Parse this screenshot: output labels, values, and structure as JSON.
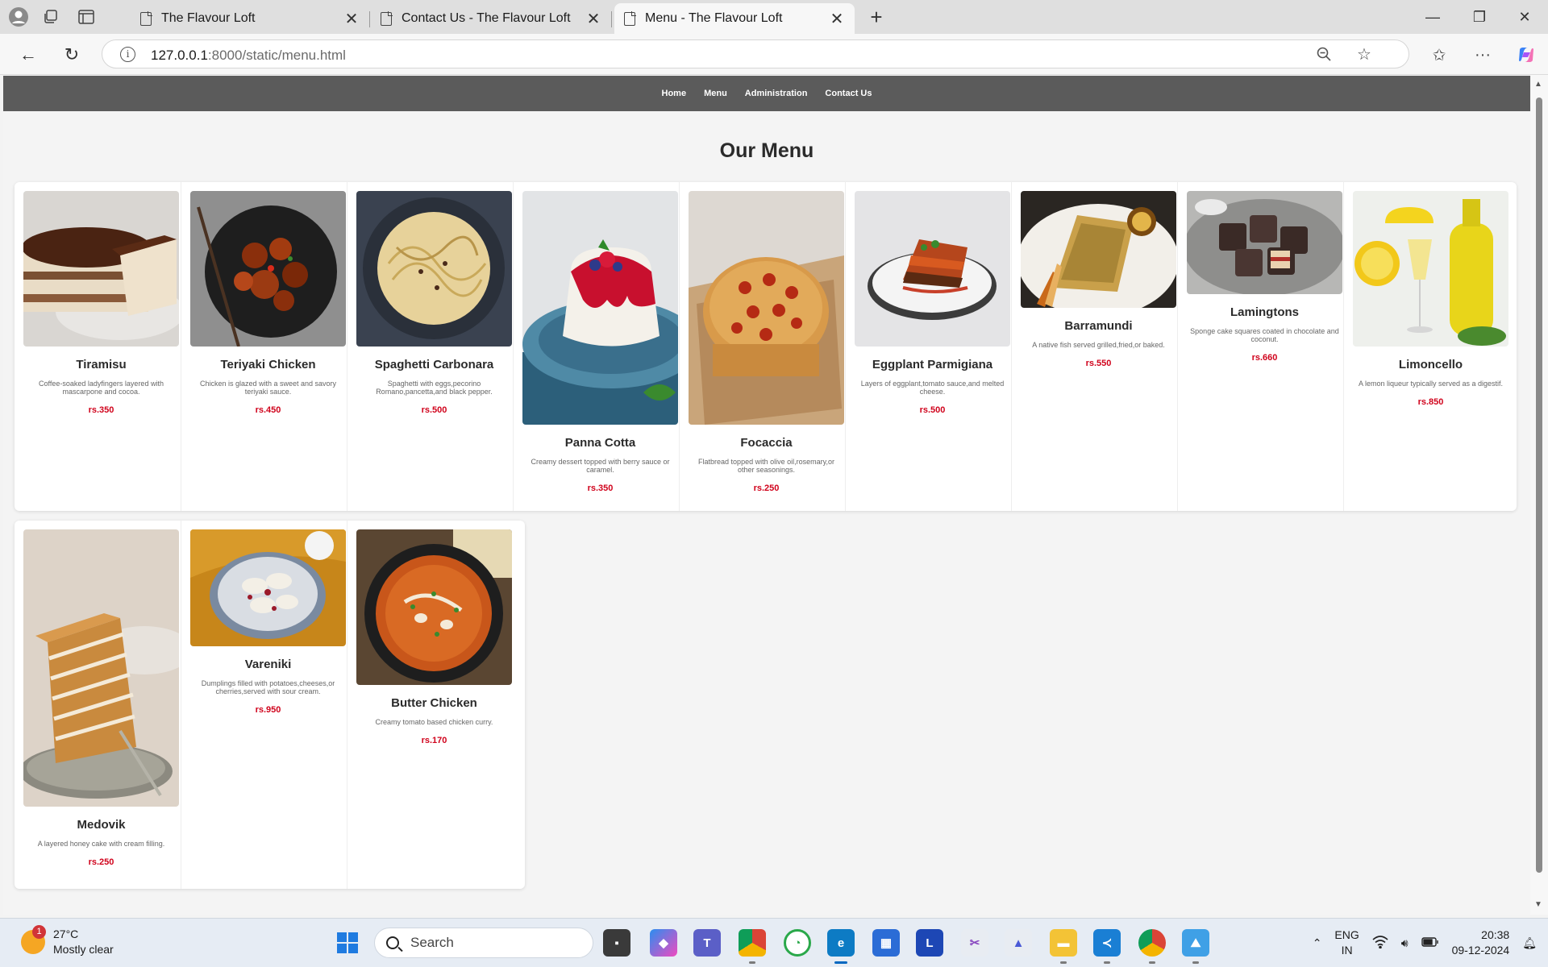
{
  "browser": {
    "tabs": [
      {
        "title": "The Flavour Loft",
        "active": false
      },
      {
        "title": "Contact Us - The Flavour Loft",
        "active": false
      },
      {
        "title": "Menu - The Flavour Loft",
        "active": true
      }
    ],
    "url_host": "127.0.0.1",
    "url_path": ":8000/static/menu.html"
  },
  "site": {
    "nav": [
      "Home",
      "Menu",
      "Administration",
      "Contact Us"
    ],
    "page_title": "Our Menu"
  },
  "menu": [
    {
      "name": "Tiramisu",
      "desc": "Coffee-soaked ladyfingers layered with mascarpone and cocoa.",
      "price": "rs.350",
      "photo": "tiramisu-photo"
    },
    {
      "name": "Teriyaki Chicken",
      "desc": "Chicken is glazed with a sweet and savory teriyaki sauce.",
      "price": "rs.450",
      "photo": "teriyaki-chicken-photo"
    },
    {
      "name": "Spaghetti Carbonara",
      "desc": "Spaghetti with eggs,pecorino Romano,pancetta,and black pepper.",
      "price": "rs.500",
      "photo": "spaghetti-carbonara-photo"
    },
    {
      "name": "Panna Cotta",
      "desc": "Creamy dessert topped with berry sauce or caramel.",
      "price": "rs.350",
      "photo": "panna-cotta-photo"
    },
    {
      "name": "Focaccia",
      "desc": "Flatbread topped with olive oil,rosemary,or other seasonings.",
      "price": "rs.250",
      "photo": "focaccia-photo"
    },
    {
      "name": "Eggplant Parmigiana",
      "desc": "Layers of eggplant,tomato sauce,and melted cheese.",
      "price": "rs.500",
      "photo": "eggplant-parmigiana-photo"
    },
    {
      "name": "Barramundi",
      "desc": "A native fish served grilled,fried,or baked.",
      "price": "rs.550",
      "photo": "barramundi-photo"
    },
    {
      "name": "Lamingtons",
      "desc": "Sponge cake squares coated in chocolate and coconut.",
      "price": "rs.660",
      "photo": "lamingtons-photo"
    },
    {
      "name": "Limoncello",
      "desc": "A lemon liqueur typically served as a digestif.",
      "price": "rs.850",
      "photo": "limoncello-photo"
    },
    {
      "name": "Medovik",
      "desc": "A layered honey cake with cream filling.",
      "price": "rs.250",
      "photo": "medovik-photo"
    },
    {
      "name": "Vareniki",
      "desc": "Dumplings filled with potatoes,cheeses,or cherries,served with sour cream.",
      "price": "rs.950",
      "photo": "vareniki-photo"
    },
    {
      "name": "Butter Chicken",
      "desc": "Creamy tomato based chicken curry.",
      "price": "rs.170",
      "photo": "butter-chicken-photo"
    }
  ],
  "taskbar": {
    "weather_temp": "27°C",
    "weather_desc": "Mostly clear",
    "weather_badge": "1",
    "search_label": "Search",
    "lang_top": "ENG",
    "lang_bottom": "IN",
    "time": "20:38",
    "date": "09-12-2024"
  },
  "colors": {
    "nav_bg": "#5b5b5b",
    "price": "#d0021b"
  }
}
